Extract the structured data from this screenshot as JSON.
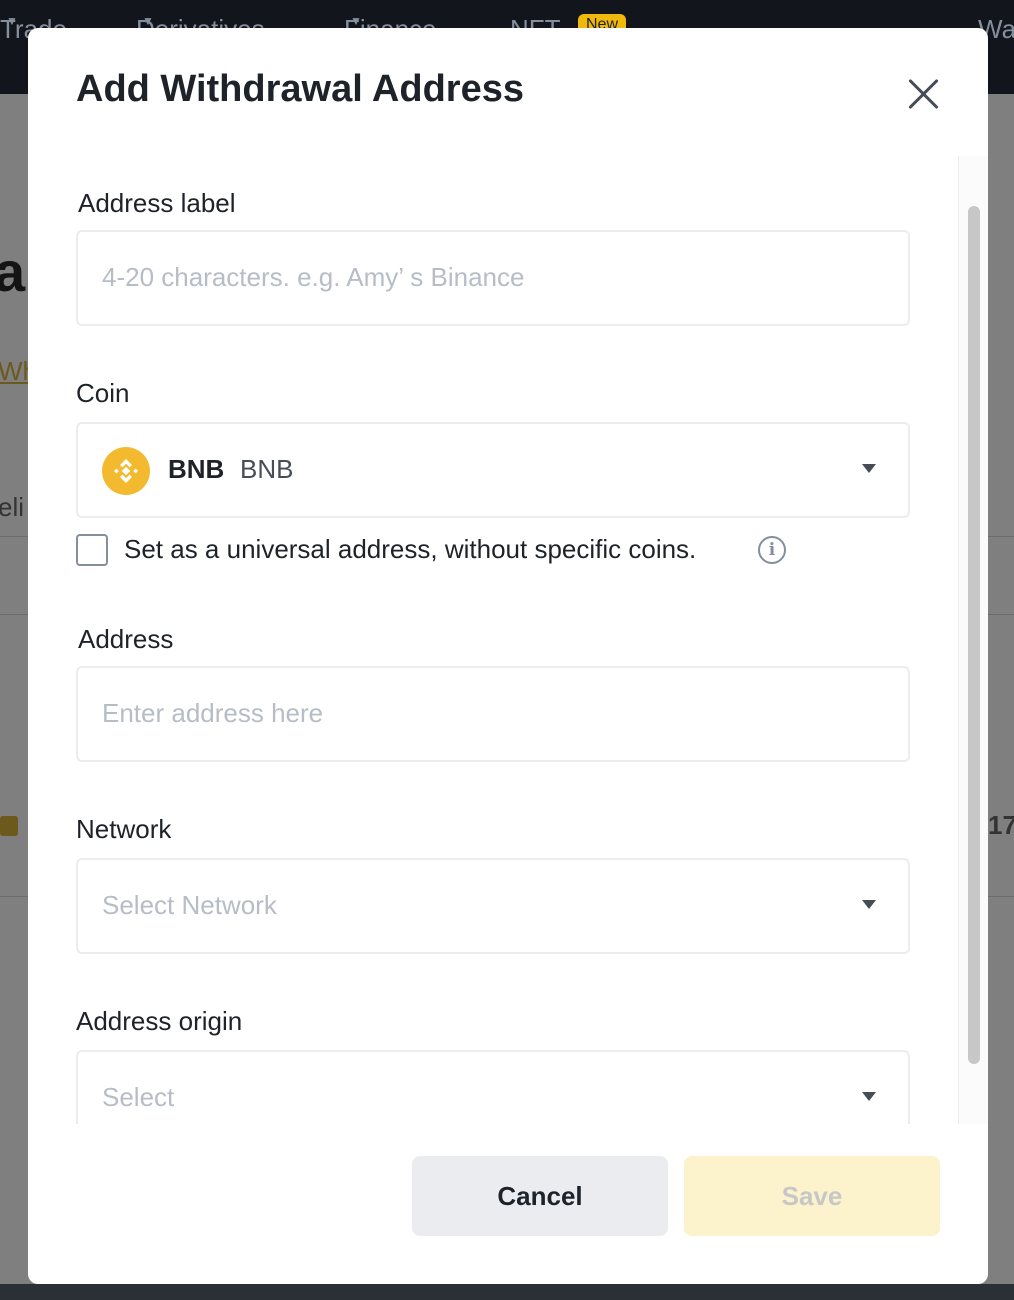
{
  "background": {
    "nav": [
      "Trade",
      "Derivatives",
      "Finance",
      "NFT",
      "Wa"
    ],
    "nav_badge": "New",
    "fragments": {
      "big_letter": "a",
      "link": "Wh",
      "list": "eli",
      "number": "17"
    }
  },
  "modal": {
    "title": "Add Withdrawal Address",
    "close_icon": "close-icon"
  },
  "form": {
    "address_label": {
      "label": "Address label",
      "placeholder": "4-20 characters. e.g. Amy’ s Binance",
      "value": ""
    },
    "coin": {
      "label": "Coin",
      "symbol": "BNB",
      "name": "BNB",
      "icon": "bnb-coin-icon",
      "icon_color": "#F3BA2F"
    },
    "universal": {
      "label": "Set as a universal address, without specific coins.",
      "checked": false,
      "info_icon": "info-icon"
    },
    "address": {
      "label": "Address",
      "placeholder": "Enter address here",
      "value": ""
    },
    "network": {
      "label": "Network",
      "placeholder": "Select Network"
    },
    "address_origin": {
      "label": "Address origin",
      "placeholder": "Select"
    }
  },
  "actions": {
    "cancel": "Cancel",
    "save": "Save"
  },
  "colors": {
    "brand": "#F0B90B",
    "save_disabled_bg": "#FCF2CC",
    "cancel_bg": "#EAECEF"
  }
}
